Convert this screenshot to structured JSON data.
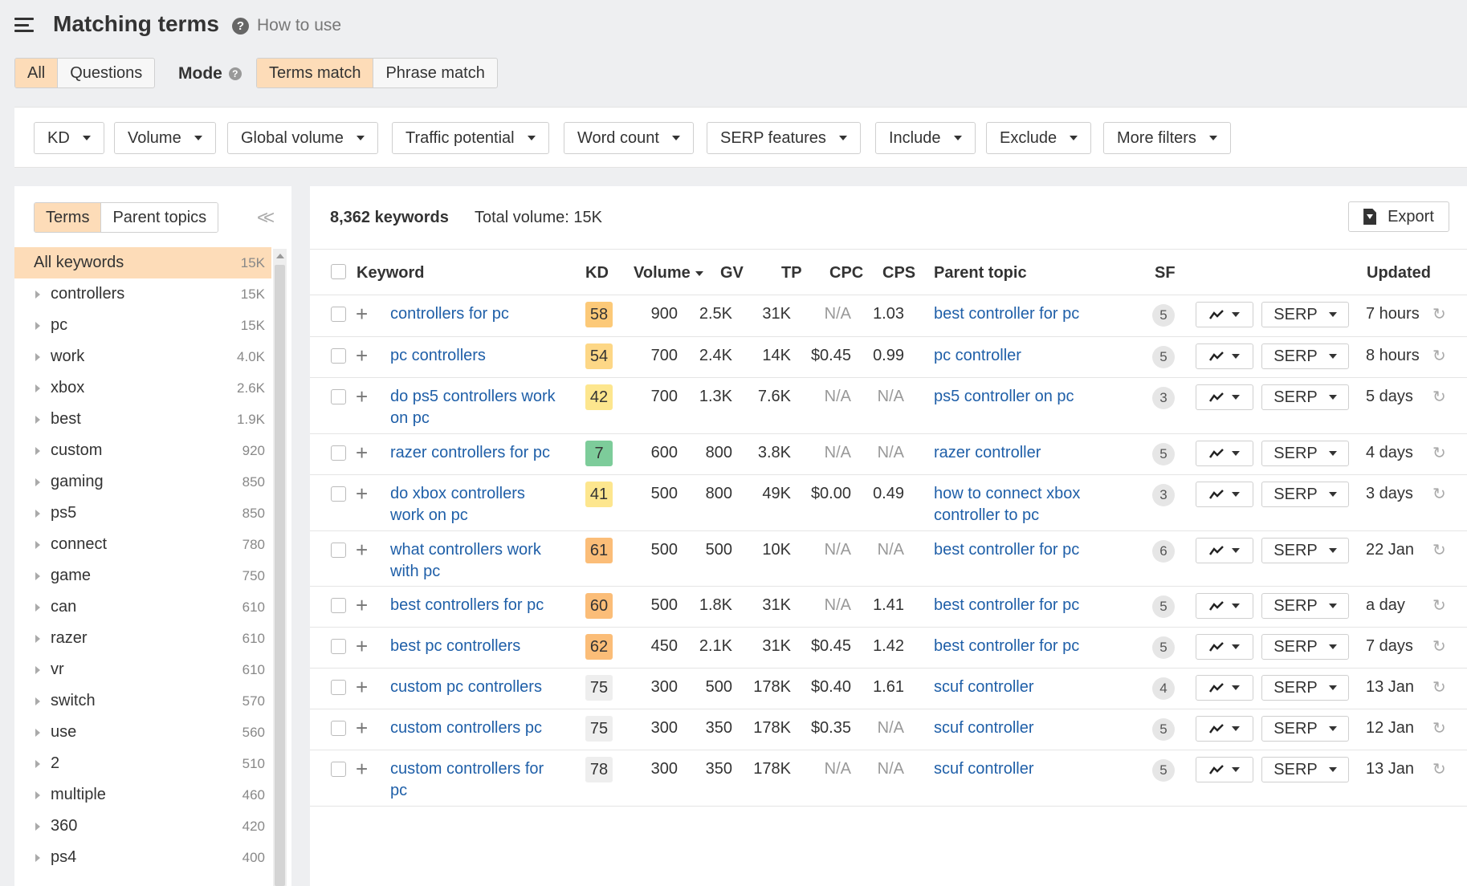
{
  "header": {
    "title": "Matching terms",
    "how_to_use": "How to use"
  },
  "tabs": {
    "all": "All",
    "questions": "Questions"
  },
  "mode": {
    "label": "Mode",
    "terms_match": "Terms match",
    "phrase_match": "Phrase match"
  },
  "filters": [
    "KD",
    "Volume",
    "Global volume",
    "Traffic potential",
    "Word count",
    "SERP features",
    "Include",
    "Exclude",
    "More filters"
  ],
  "sidebar": {
    "tab_terms": "Terms",
    "tab_parent": "Parent topics",
    "items": [
      {
        "label": "All keywords",
        "count": "15K"
      },
      {
        "label": "controllers",
        "count": "15K"
      },
      {
        "label": "pc",
        "count": "15K"
      },
      {
        "label": "work",
        "count": "4.0K"
      },
      {
        "label": "xbox",
        "count": "2.6K"
      },
      {
        "label": "best",
        "count": "1.9K"
      },
      {
        "label": "custom",
        "count": "920"
      },
      {
        "label": "gaming",
        "count": "850"
      },
      {
        "label": "ps5",
        "count": "850"
      },
      {
        "label": "connect",
        "count": "780"
      },
      {
        "label": "game",
        "count": "750"
      },
      {
        "label": "can",
        "count": "610"
      },
      {
        "label": "razer",
        "count": "610"
      },
      {
        "label": "vr",
        "count": "610"
      },
      {
        "label": "switch",
        "count": "570"
      },
      {
        "label": "use",
        "count": "560"
      },
      {
        "label": "2",
        "count": "510"
      },
      {
        "label": "multiple",
        "count": "460"
      },
      {
        "label": "360",
        "count": "420"
      },
      {
        "label": "ps4",
        "count": "400"
      }
    ]
  },
  "summary": {
    "count": "8,362 keywords",
    "total_volume": "Total volume: 15K",
    "export": "Export"
  },
  "columns": {
    "keyword": "Keyword",
    "kd": "KD",
    "volume": "Volume",
    "gv": "GV",
    "tp": "TP",
    "cpc": "CPC",
    "cps": "CPS",
    "parent_topic": "Parent topic",
    "sf": "SF",
    "updated": "Updated"
  },
  "serp_label": "SERP",
  "rows": [
    {
      "keyword": "controllers for pc",
      "kd": "58",
      "kd_color": "#fcc978",
      "volume": "900",
      "gv": "2.5K",
      "tp": "31K",
      "cpc": "N/A",
      "cps": "1.03",
      "parent": "best controller for pc",
      "sf": "5",
      "updated": "7 hours"
    },
    {
      "keyword": "pc controllers",
      "kd": "54",
      "kd_color": "#fdd786",
      "volume": "700",
      "gv": "2.4K",
      "tp": "14K",
      "cpc": "$0.45",
      "cps": "0.99",
      "parent": "pc controller",
      "sf": "5",
      "updated": "8 hours"
    },
    {
      "keyword": "do ps5 controllers work on pc",
      "kd": "42",
      "kd_color": "#fde68e",
      "volume": "700",
      "gv": "1.3K",
      "tp": "7.6K",
      "cpc": "N/A",
      "cps": "N/A",
      "parent": "ps5 controller on pc",
      "sf": "3",
      "updated": "5 days"
    },
    {
      "keyword": "razer controllers for pc",
      "kd": "7",
      "kd_color": "#7dcc9a",
      "volume": "600",
      "gv": "800",
      "tp": "3.8K",
      "cpc": "N/A",
      "cps": "N/A",
      "parent": "razer controller",
      "sf": "5",
      "updated": "4 days"
    },
    {
      "keyword": "do xbox controllers work on pc",
      "kd": "41",
      "kd_color": "#fde68e",
      "volume": "500",
      "gv": "800",
      "tp": "49K",
      "cpc": "$0.00",
      "cps": "0.49",
      "parent": "how to connect xbox controller to pc",
      "sf": "3",
      "updated": "3 days"
    },
    {
      "keyword": "what controllers work with pc",
      "kd": "61",
      "kd_color": "#fbbd78",
      "volume": "500",
      "gv": "500",
      "tp": "10K",
      "cpc": "N/A",
      "cps": "N/A",
      "parent": "best controller for pc",
      "sf": "6",
      "updated": "22 Jan"
    },
    {
      "keyword": "best controllers for pc",
      "kd": "60",
      "kd_color": "#fbbd78",
      "volume": "500",
      "gv": "1.8K",
      "tp": "31K",
      "cpc": "N/A",
      "cps": "1.41",
      "parent": "best controller for pc",
      "sf": "5",
      "updated": "a day"
    },
    {
      "keyword": "best pc controllers",
      "kd": "62",
      "kd_color": "#fbbd78",
      "volume": "450",
      "gv": "2.1K",
      "tp": "31K",
      "cpc": "$0.45",
      "cps": "1.42",
      "parent": "best controller for pc",
      "sf": "5",
      "updated": "7 days"
    },
    {
      "keyword": "custom pc controllers",
      "kd": "75",
      "kd_color": "#eeeeee",
      "volume": "300",
      "gv": "500",
      "tp": "178K",
      "cpc": "$0.40",
      "cps": "1.61",
      "parent": "scuf controller",
      "sf": "4",
      "updated": "13 Jan"
    },
    {
      "keyword": "custom controllers pc",
      "kd": "75",
      "kd_color": "#eeeeee",
      "volume": "300",
      "gv": "350",
      "tp": "178K",
      "cpc": "$0.35",
      "cps": "N/A",
      "parent": "scuf controller",
      "sf": "5",
      "updated": "12 Jan"
    },
    {
      "keyword": "custom controllers for pc",
      "kd": "78",
      "kd_color": "#eeeeee",
      "volume": "300",
      "gv": "350",
      "tp": "178K",
      "cpc": "N/A",
      "cps": "N/A",
      "parent": "scuf controller",
      "sf": "5",
      "updated": "13 Jan"
    }
  ]
}
